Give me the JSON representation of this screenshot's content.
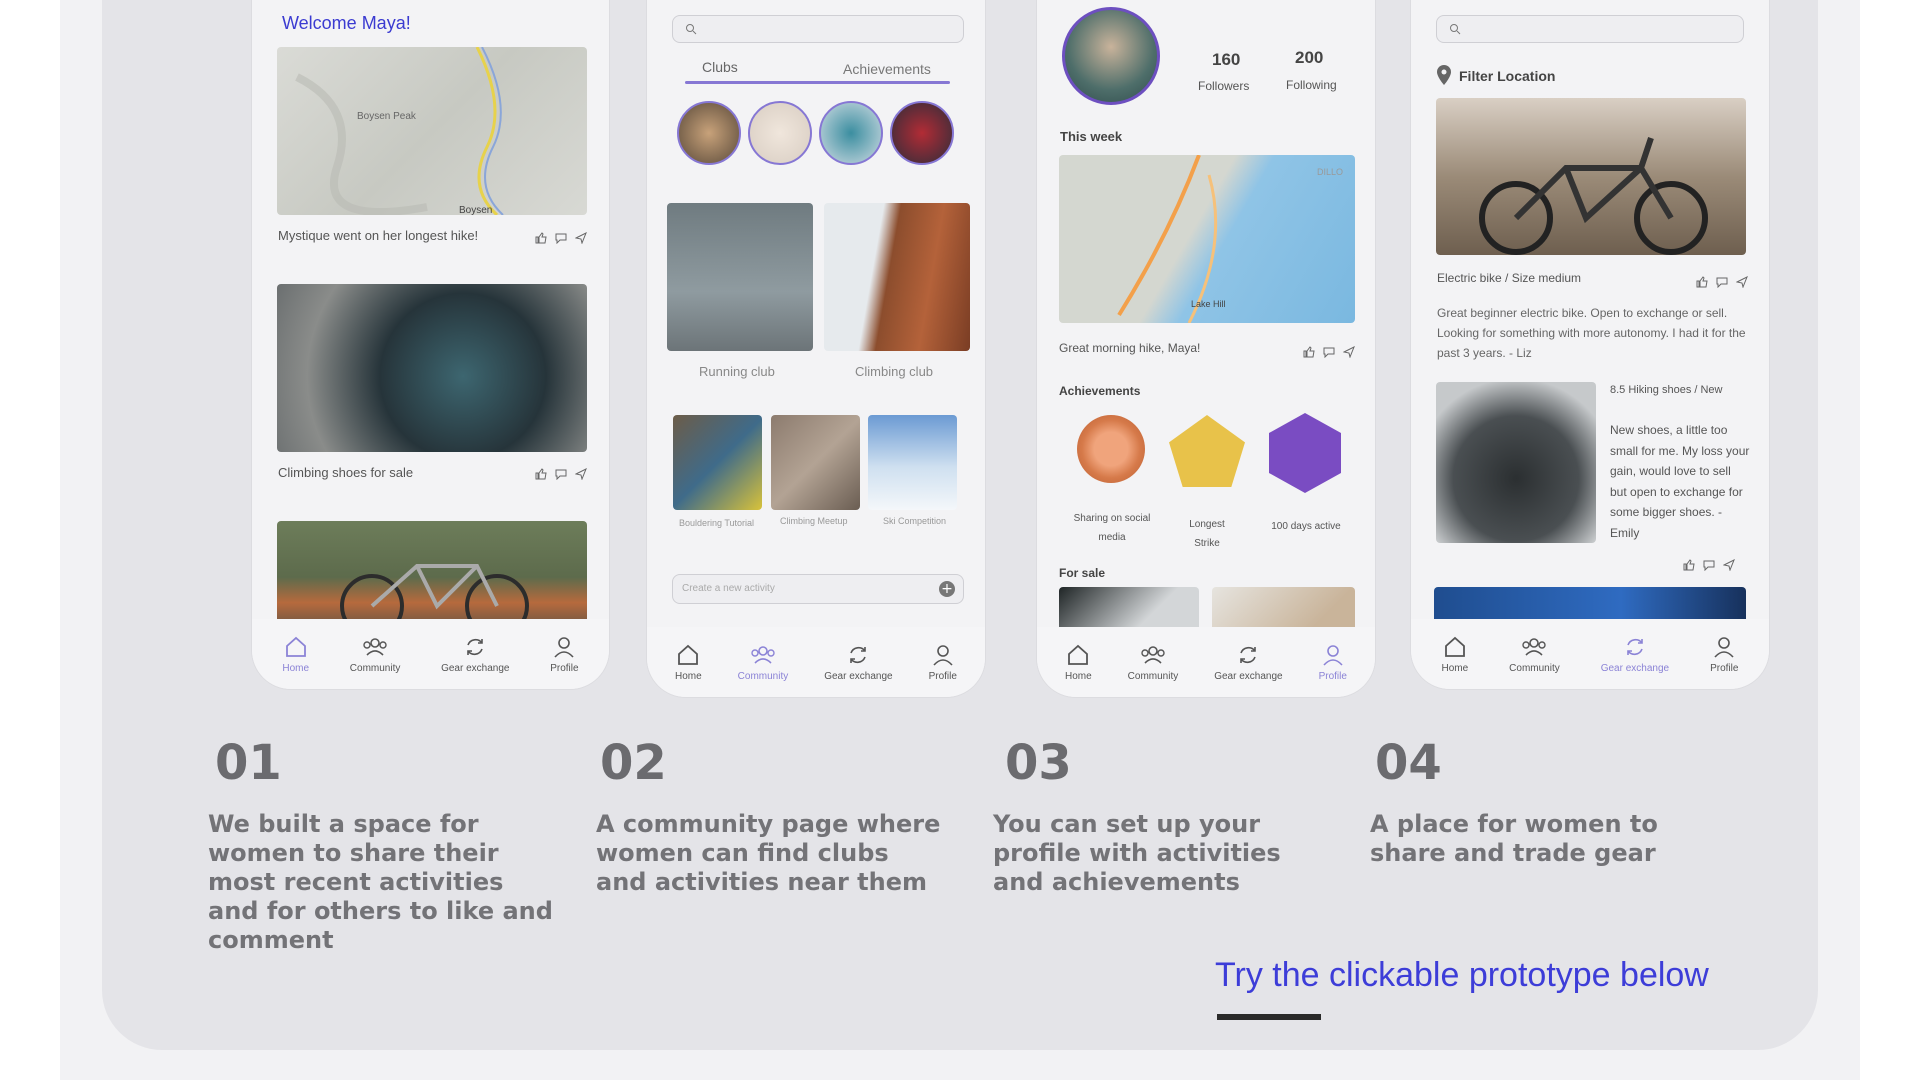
{
  "tabs": {
    "home": "Home",
    "community": "Community",
    "gear": "Gear exchange",
    "profile": "Profile"
  },
  "screen1": {
    "welcome": "Welcome Maya!",
    "map_label_peak": "Boysen Peak",
    "map_label_town": "Boysen",
    "post1": "Mystique went on her longest hike!",
    "post2": "Climbing shoes for sale"
  },
  "screen2": {
    "tab_clubs": "Clubs",
    "tab_achievements": "Achievements",
    "club1": "Running club",
    "club2": "Climbing club",
    "act1": "Bouldering Tutorial",
    "act2": "Climbing Meetup",
    "act3": "Ski Competition",
    "new_activity_placeholder": "Create a new activity"
  },
  "screen3": {
    "followers_count": "160",
    "followers_label": "Followers",
    "following_count": "200",
    "following_label": "Following",
    "this_week": "This week",
    "map_label_lake": "Lake Hill",
    "map_label_dill": "DILLO",
    "post": "Great morning hike, Maya!",
    "achievements": "Achievements",
    "ach1": "Sharing on social media",
    "ach2": "Longest Strike",
    "ach3": "100 days active",
    "for_sale": "For sale",
    "colors": {
      "bronze": "#d67a4a",
      "gold": "#e8c24a",
      "purple": "#7a4cc2"
    }
  },
  "screen4": {
    "filter": "Filter Location",
    "item1_title": "Electric bike / Size medium",
    "item1_desc": "Great beginner electric bike. Open to exchange or sell. Looking for something with more autonomy. I had it for the past 3 years.  - Liz",
    "item2_title": "8.5 Hiking shoes / New",
    "item2_desc": "New shoes, a little too small for me.  My loss your gain, would love to sell but open to exchange for some bigger shoes. - Emily"
  },
  "steps": [
    {
      "num": "01",
      "text": "We built a space for women to share their most recent activities and for others to like and comment"
    },
    {
      "num": "02",
      "text": "A community page where women can find clubs and activities near them"
    },
    {
      "num": "03",
      "text": "You can set up your profile with activities and achievements"
    },
    {
      "num": "04",
      "text": "A place for women to share and trade gear"
    }
  ],
  "cta": "Try the clickable prototype below",
  "accent": "#3d3dd8"
}
